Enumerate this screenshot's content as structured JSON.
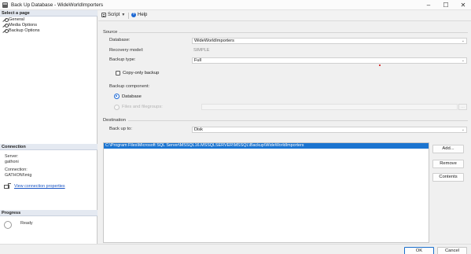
{
  "window": {
    "title": "Back Up Database - WideWorldImporters",
    "app_icon": "database-backup-icon",
    "controls": {
      "minimize": "–",
      "maximize": "☐",
      "close": "✕"
    }
  },
  "sidebar": {
    "select_page_header": "Select a page",
    "pages": [
      {
        "label": "General",
        "icon": "wrench-icon"
      },
      {
        "label": "Media Options",
        "icon": "wrench-icon"
      },
      {
        "label": "Backup Options",
        "icon": "wrench-icon"
      }
    ],
    "connection_header": "Connection",
    "server_label": "Server:",
    "server_value": "gathoni",
    "connection_label": "Connection:",
    "connection_value": "GATHONI\\mig",
    "view_connection_link": "View connection properties",
    "progress_header": "Progress",
    "progress_status": "Ready"
  },
  "toolbar": {
    "script_label": "Script",
    "help_label": "Help"
  },
  "source": {
    "section_label": "Source",
    "database_label": "Database:",
    "database_value": "WideWorldImporters",
    "recovery_label": "Recovery model:",
    "recovery_value": "SIMPLE",
    "backup_type_label": "Backup type:",
    "backup_type_value": "Full",
    "copy_only_label": "Copy-only backup",
    "copy_only_checked": false,
    "component_label": "Backup component:",
    "component_database": "Database",
    "component_files": "Files and filegroups:",
    "selected_component": "Database"
  },
  "destination": {
    "section_label": "Destination",
    "backup_to_label": "Back up to:",
    "backup_to_value": "Disk",
    "paths": [
      "C:\\Program Files\\Microsoft SQL Server\\MSSQL16.MSSQLSERVER\\MSSQL\\Backup\\WideWorldImporters"
    ],
    "add_label": "Add...",
    "remove_label": "Remove",
    "contents_label": "Contents"
  },
  "footer": {
    "ok_label": "OK",
    "cancel_label": "Cancel"
  },
  "colors": {
    "accent": "#1b74d0",
    "link": "#1a55c4",
    "header_bg": "#e4e9f1"
  }
}
